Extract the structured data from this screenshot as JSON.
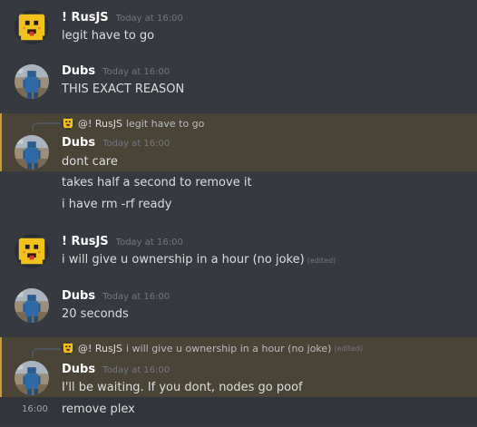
{
  "messages": [
    {
      "author": "! RusJS",
      "timestamp": "Today at 16:00",
      "lines": [
        "legit have to go"
      ]
    },
    {
      "author": "Dubs",
      "timestamp": "Today at 16:00",
      "lines": [
        "THIS EXACT REASON"
      ]
    },
    {
      "reply": {
        "author": "@! RusJS",
        "text": "legit have to go"
      },
      "author": "Dubs",
      "timestamp": "Today at 16:00",
      "lines": [
        "dont care",
        "takes half a second to remove it",
        "i have rm -rf ready"
      ]
    },
    {
      "author": "! RusJS",
      "timestamp": "Today at 16:00",
      "lines": [
        "i will give u ownership in a hour (no joke)"
      ],
      "edited": "(edited)"
    },
    {
      "author": "Dubs",
      "timestamp": "Today at 16:00",
      "lines": [
        "20 seconds"
      ]
    },
    {
      "reply": {
        "author": "@! RusJS",
        "text": "i will give u ownership in a hour (no joke)",
        "edited": "(edited)"
      },
      "author": "Dubs",
      "timestamp": "Today at 16:00",
      "lines": [
        "I'll be waiting. If you dont, nodes go poof",
        "remove plex"
      ],
      "hover_timestamp": "16:00"
    }
  ],
  "colors": {
    "background": "#36393f",
    "mention_highlight": "#4a4437",
    "mention_bar": "#c99a2e"
  },
  "icons": {
    "rusjs_avatar": "pixel-smiley-avatar-icon",
    "dubs_avatar": "pixel-blue-figure-avatar-icon"
  }
}
